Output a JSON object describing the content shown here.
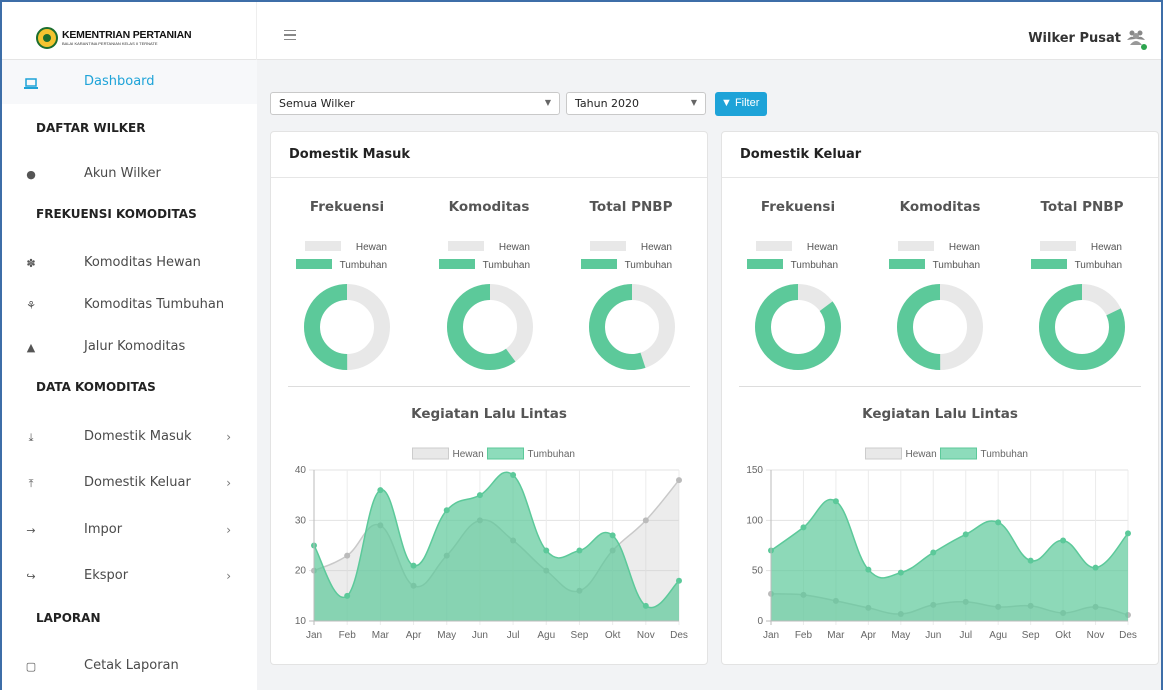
{
  "header": {
    "brand_title": "KEMENTRIAN PERTANIAN",
    "brand_subtitle": "BALAI KARANTINA PERTANIAN KELAS II TERNATE",
    "user_name": "Wilker Pusat"
  },
  "sidebar": {
    "dashboard": "Dashboard",
    "section_daftar": "DAFTAR WILKER",
    "akun_wilker": "Akun Wilker",
    "section_frekuensi": "FREKUENSI KOMODITAS",
    "komoditas_hewan": "Komoditas Hewan",
    "komoditas_tumbuhan": "Komoditas Tumbuhan",
    "jalur_komoditas": "Jalur Komoditas",
    "section_data": "DATA KOMODITAS",
    "domestik_masuk": "Domestik Masuk",
    "domestik_keluar": "Domestik Keluar",
    "impor": "Impor",
    "ekspor": "Ekspor",
    "section_laporan": "LAPORAN",
    "cetak_laporan": "Cetak Laporan"
  },
  "filters": {
    "wilker_value": "Semua Wilker",
    "tahun_value": "Tahun 2020",
    "filter_label": "Filter"
  },
  "colors": {
    "hewan": "#e8e8e8",
    "tumbuhan": "#5cc99a",
    "accent": "#1ea3d8"
  },
  "cards": {
    "masuk_title": "Domestik Masuk",
    "keluar_title": "Domestik Keluar",
    "col_frekuensi": "Frekuensi",
    "col_komoditas": "Komoditas",
    "col_pnbp": "Total PNBP",
    "legend_hewan": "Hewan",
    "legend_tumbuhan": "Tumbuhan",
    "chart_title": "Kegiatan Lalu Lintas"
  },
  "chart_data": [
    {
      "type": "pie",
      "card": "Domestik Masuk",
      "title": "Frekuensi",
      "categories": [
        "Hewan",
        "Tumbuhan"
      ],
      "values": [
        50,
        50
      ]
    },
    {
      "type": "pie",
      "card": "Domestik Masuk",
      "title": "Komoditas",
      "categories": [
        "Hewan",
        "Tumbuhan"
      ],
      "values": [
        40,
        60
      ]
    },
    {
      "type": "pie",
      "card": "Domestik Masuk",
      "title": "Total PNBP",
      "categories": [
        "Hewan",
        "Tumbuhan"
      ],
      "values": [
        45,
        55
      ]
    },
    {
      "type": "pie",
      "card": "Domestik Keluar",
      "title": "Frekuensi",
      "categories": [
        "Hewan",
        "Tumbuhan"
      ],
      "values": [
        15,
        85
      ]
    },
    {
      "type": "pie",
      "card": "Domestik Keluar",
      "title": "Komoditas",
      "categories": [
        "Hewan",
        "Tumbuhan"
      ],
      "values": [
        50,
        50
      ]
    },
    {
      "type": "pie",
      "card": "Domestik Keluar",
      "title": "Total PNBP",
      "categories": [
        "Hewan",
        "Tumbuhan"
      ],
      "values": [
        18,
        82
      ]
    },
    {
      "type": "area",
      "card": "Domestik Masuk",
      "title": "Kegiatan Lalu Lintas",
      "categories": [
        "Jan",
        "Feb",
        "Mar",
        "Apr",
        "May",
        "Jun",
        "Jul",
        "Agu",
        "Sep",
        "Okt",
        "Nov",
        "Des"
      ],
      "series": [
        {
          "name": "Hewan",
          "values": [
            20,
            23,
            29,
            17,
            23,
            30,
            26,
            20,
            16,
            24,
            30,
            38
          ]
        },
        {
          "name": "Tumbuhan",
          "values": [
            25,
            15,
            36,
            21,
            32,
            35,
            39,
            24,
            24,
            27,
            13,
            18
          ]
        }
      ],
      "ylim": [
        10,
        40
      ],
      "yticks": [
        10,
        20,
        30,
        40
      ]
    },
    {
      "type": "area",
      "card": "Domestik Keluar",
      "title": "Kegiatan Lalu Lintas",
      "categories": [
        "Jan",
        "Feb",
        "Mar",
        "Apr",
        "May",
        "Jun",
        "Jul",
        "Agu",
        "Sep",
        "Okt",
        "Nov",
        "Des"
      ],
      "series": [
        {
          "name": "Hewan",
          "values": [
            27,
            26,
            20,
            13,
            7,
            16,
            19,
            14,
            15,
            8,
            14,
            6
          ]
        },
        {
          "name": "Tumbuhan",
          "values": [
            70,
            93,
            119,
            51,
            48,
            68,
            86,
            98,
            60,
            80,
            53,
            87
          ]
        }
      ],
      "ylim": [
        0,
        150
      ],
      "yticks": [
        0,
        50,
        100,
        150
      ]
    }
  ]
}
